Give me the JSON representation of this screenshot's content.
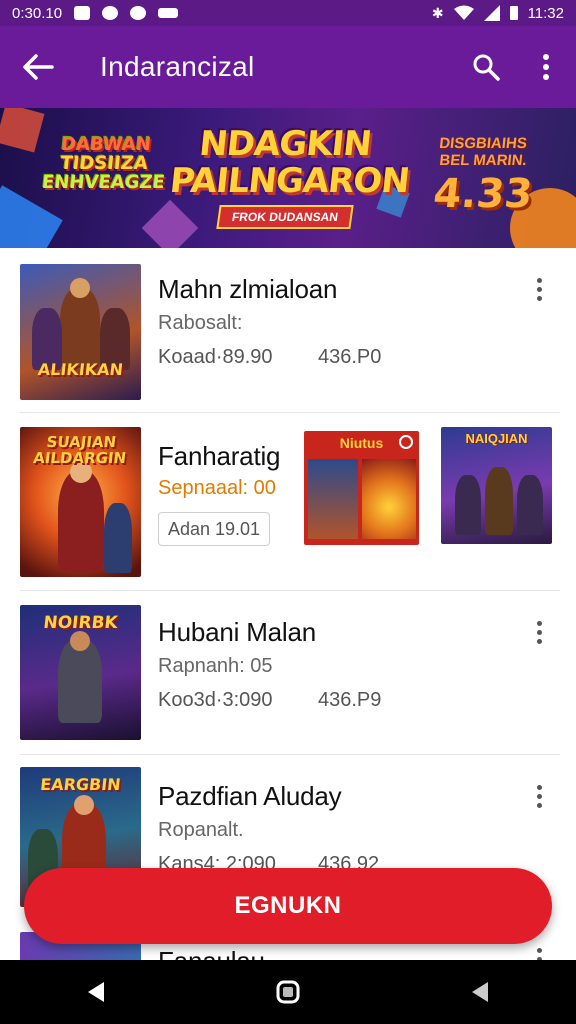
{
  "status_bar": {
    "time_left": "0:30.10",
    "time_right": "11:32"
  },
  "app_bar": {
    "title": "Indarancizal",
    "back_icon": "arrow-left-icon",
    "search_icon": "search-icon",
    "more_icon": "more-vertical-icon"
  },
  "banner": {
    "left_text": [
      "DABWAN",
      "TIDSIIZA",
      "ENHVEAGZE"
    ],
    "headline": [
      "NDAGKIN",
      "PAILNGARON"
    ],
    "ribbon": "FROK DUDANSAN",
    "right_text": [
      "DISGBIAIHS",
      "BEL MARIN."
    ],
    "price": "4.33"
  },
  "items": [
    {
      "title": "Mahn zlmialoan",
      "subtitle": "Rabosalt:",
      "meta_left": "Koaad·89.90",
      "meta_right": "436.P0",
      "thumb_title": "ALIKIKAN"
    },
    {
      "title": "Fanharatig",
      "subtitle": "Sepnaaal: 00",
      "pill": "Adan 19.01",
      "thumb_title": "SUAJIAN AILDARGIN",
      "mini_cards": [
        {
          "title": "Niutus"
        },
        {
          "title": "NAIQJIAN"
        }
      ]
    },
    {
      "title": "Hubani Malan",
      "subtitle": "Rapnanh: 05",
      "meta_left": "Koo3d·3:090",
      "meta_right": "436.P9",
      "thumb_title": "NOIRBK"
    },
    {
      "title": "Pazdfian Aluday",
      "subtitle": "Ropanalt.",
      "meta_left": "Kans4: 2:090",
      "meta_right": "436.92",
      "thumb_title": "EARGBIN"
    },
    {
      "title": "Fanaulau"
    }
  ],
  "cta": {
    "label": "EGNUKN"
  },
  "nav": {
    "back_icon": "nav-back-icon",
    "home_icon": "nav-home-icon",
    "recents_icon": "nav-recents-icon"
  }
}
